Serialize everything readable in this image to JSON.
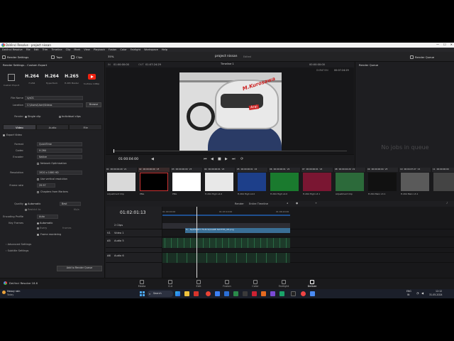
{
  "window": {
    "title": "DaVinci Resolve - project nissan",
    "controls": [
      "—",
      "☐",
      "✕"
    ]
  },
  "menu": [
    "DaVinci Resolve",
    "File",
    "Edit",
    "Trim",
    "Timeline",
    "Clip",
    "Mark",
    "View",
    "Playback",
    "Fusion",
    "Color",
    "Fairlight",
    "Workspace",
    "Help"
  ],
  "toolbar": {
    "render_settings": "Render Settings",
    "tape": "Tape",
    "clips": "Clips",
    "zoom": "35%",
    "project": "project nissan",
    "edited": "Edited",
    "timeline": "Timeline 1",
    "render_queue": "Render Queue"
  },
  "left_panel": {
    "title": "Render Settings - Custom Export",
    "presets": [
      {
        "big": "",
        "label": "Custom Export"
      },
      {
        "big": "H.264",
        "label": "H.264"
      },
      {
        "big": "H.264",
        "label": "HyperDeck"
      },
      {
        "big": "H.265",
        "label": "H.265 Master"
      },
      {
        "big": "",
        "label": "YouTube 1080p"
      }
    ],
    "file_name_label": "File Name",
    "file_name": "sys01",
    "location_label": "Location",
    "location": "C:\\Users\\User\\Videos",
    "browse": "Browse",
    "render_label": "Render",
    "single_clip": "Single clip",
    "individual_clips": "Individual clips",
    "tabs": [
      "Video",
      "Audio",
      "File"
    ],
    "export_video": "Export Video",
    "format_label": "Format",
    "format": "QuickTime",
    "codec_label": "Codec",
    "codec": "H.264",
    "encoder_label": "Encoder",
    "encoder": "Native",
    "network_opt": "Network Optimization",
    "resolution_label": "Resolution",
    "resolution": "1920 x 1080 HD",
    "vertical_res": "Use vertical resolution",
    "frame_rate_label": "Frame rate",
    "frame_rate": "29.97",
    "chapters": "Chapters from Markers",
    "quality_label": "Quality",
    "quality_auto": "Automatic",
    "quality_best": "Best",
    "restrict_to": "Restrict to",
    "kbps": "Kb/s",
    "enc_profile_label": "Encoding Profile",
    "enc_profile": "Auto",
    "key_frames_label": "Key Frames",
    "kf_auto": "Automatic",
    "kf_every": "Every",
    "frames": "frames",
    "frame_reorder": "Frame reordering",
    "advanced": "Advanced Settings",
    "subtitle": "Subtitle Settings",
    "add_queue": "Add to Render Queue"
  },
  "viewer": {
    "in_label": "IN",
    "in_tc": "01:00:00:00",
    "out_label": "OUT",
    "out_tc": "01:07:24:29",
    "right_tc": "00:00:00:00",
    "duration_label": "DURATION",
    "duration": "00:07:24:29",
    "timecode": "01:00:04:00",
    "helmet_text": "M.Kurosawa",
    "arai": "Arai"
  },
  "queue": {
    "empty": "No jobs in queue"
  },
  "clips": [
    {
      "n": "01",
      "tc": "00:00:04:29",
      "trk": "V1",
      "name": "Adjustment Clip",
      "color": "#d9d9d9"
    },
    {
      "n": "02",
      "tc": "00:00:00:00",
      "trk": "V3",
      "name": "PNG",
      "color": "#000000"
    },
    {
      "n": "03",
      "tc": "00:00:00:00",
      "trk": "V3",
      "name": "PNG",
      "color": "#ffffff"
    },
    {
      "n": "04",
      "tc": "00:00:00:01",
      "trk": "V2",
      "name": "H.264 High L4.0",
      "color": "#e8e8e8"
    },
    {
      "n": "05",
      "tc": "00:00:00:01",
      "trk": "V2",
      "name": "H.264 High L4.0",
      "color": "#1d3f8a"
    },
    {
      "n": "06",
      "tc": "00:00:00:01",
      "trk": "V2",
      "name": "H.264 High L4.0",
      "color": "#1a7a2e"
    },
    {
      "n": "07",
      "tc": "00:00:00:01",
      "trk": "V2",
      "name": "H.264 High L3.1",
      "color": "#7a1632"
    },
    {
      "n": "08",
      "tc": "00:00:04:29",
      "trk": "V1",
      "name": "Adjustment Clip",
      "color": "#2c6a3a"
    },
    {
      "n": "09",
      "tc": "00:00:00:04",
      "trk": "V3",
      "name": "H.264 Main L3.1",
      "color": "#111111"
    },
    {
      "n": "10",
      "tc": "00:04:07:27",
      "trk": "V1",
      "name": "H.264 Main L3.1",
      "color": "#5a5a5a"
    },
    {
      "n": "11",
      "tc": "00:00:00:00",
      "trk": "",
      "name": "",
      "color": "#444444"
    }
  ],
  "timeline_toolbar": {
    "render": "Render",
    "range": "Entire Timeline"
  },
  "timeline": {
    "timecode": "01:02:01:13",
    "ruler": [
      "01:00:00:00",
      "01:03:10:00",
      "01:06:20:00"
    ],
    "tracks": [
      {
        "id": "",
        "name": "2 Clips"
      },
      {
        "id": "V1",
        "name": "Video 1"
      },
      {
        "id": "A5",
        "name": "Audio 5"
      },
      {
        "id": "",
        "name": ""
      },
      {
        "id": "A6",
        "name": "Audio 6"
      }
    ],
    "clip_label": "fx - NeWDIRTY FILM SQUARE MATTES_08.png"
  },
  "pages": [
    {
      "name": "Media",
      "active": false
    },
    {
      "name": "Cut",
      "active": false
    },
    {
      "name": "Edit",
      "active": false
    },
    {
      "name": "Fusion",
      "active": false
    },
    {
      "name": "Color",
      "active": false
    },
    {
      "name": "Fairlight",
      "active": false
    },
    {
      "name": "Deliver",
      "active": true
    }
  ],
  "app_footer": "DaVinci Resolve 18.6",
  "taskbar": {
    "weather_line1": "Heavy rain",
    "weather_line2": "Today",
    "search": "Search",
    "lang1": "ENG",
    "lang2": "IN",
    "time": "12:12",
    "date": "31-05-2024"
  }
}
